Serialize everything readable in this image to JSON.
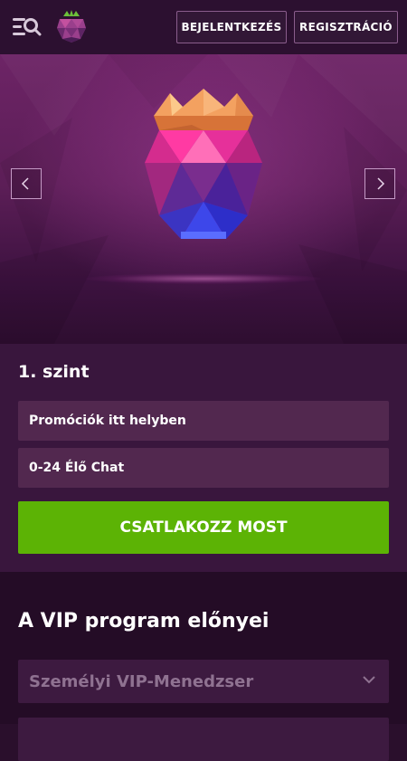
{
  "header": {
    "menu_icon": "menu-search-icon",
    "logo_icon": "raspberry-gem-logo",
    "login_label": "BEJELENTKEZÉS",
    "register_label": "REGISZTRÁCIÓ"
  },
  "hero": {
    "image_icon": "crowned-gem",
    "prev_icon": "chevron-left-icon",
    "next_icon": "chevron-right-icon"
  },
  "level": {
    "title": "1. szint",
    "perks": [
      "Promóciók itt helyben",
      "0-24 Élő Chat"
    ],
    "cta_label": "CSATLAKOZZ MOST"
  },
  "vip": {
    "title": "A VIP program előnyei",
    "items": [
      {
        "label": "Személyi VIP-Menedzser",
        "icon": "chevron-down-icon"
      },
      {
        "label": "",
        "icon": ""
      }
    ]
  },
  "colors": {
    "header_bg": "#2c1030",
    "hero_top": "#6d2466",
    "level_bg": "#39163d",
    "perk_bg": "#52284f",
    "cta_green": "#5cb305",
    "vip_bg": "#240c26",
    "accordion_bg": "#3d1a40",
    "accordion_text": "#8f7291"
  }
}
